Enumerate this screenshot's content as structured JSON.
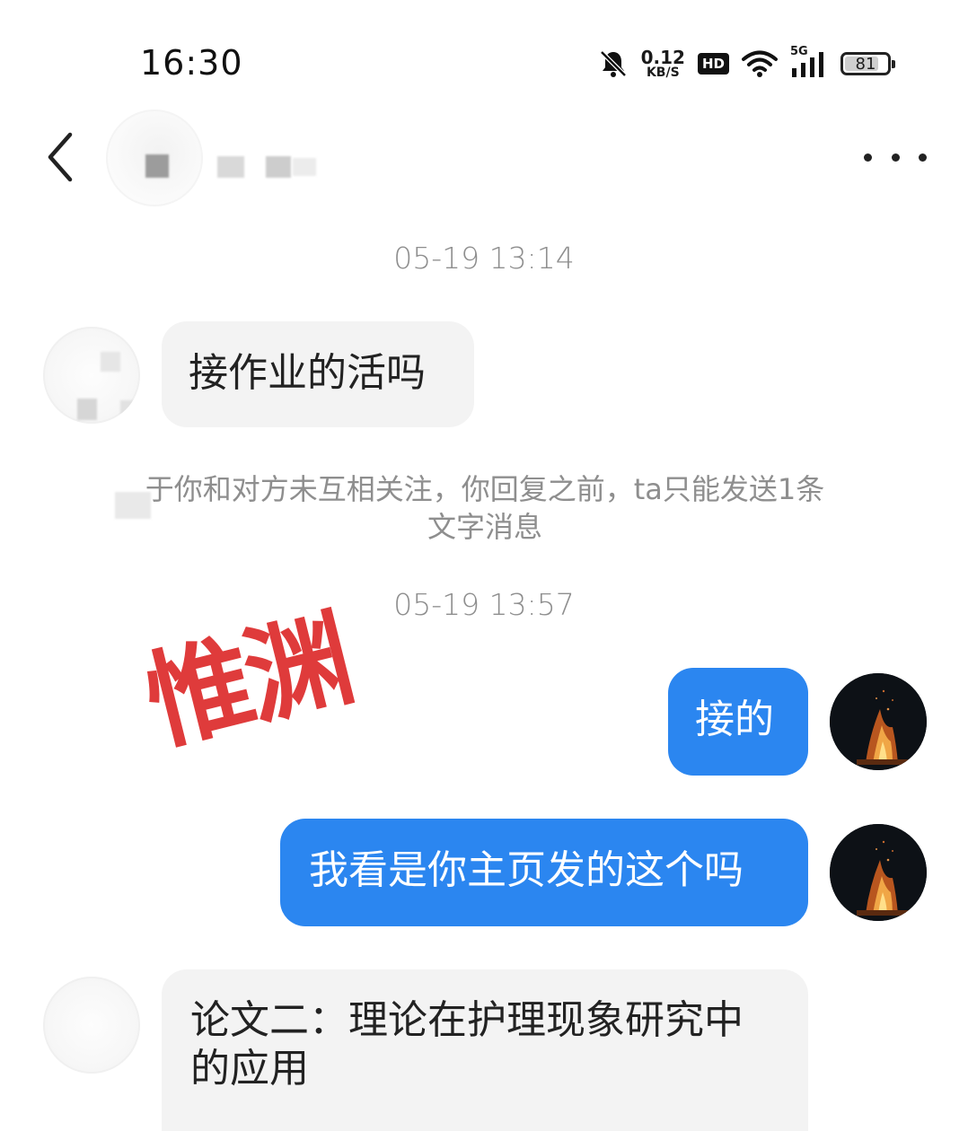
{
  "status_bar": {
    "time": "16:30",
    "net_speed_value": "0.12",
    "net_speed_unit": "KB/S",
    "hd_badge": "HD",
    "network_label": "5G",
    "battery_level": "81",
    "icons": [
      "bell-muted-icon",
      "wifi-icon",
      "signal-icon",
      "battery-icon"
    ]
  },
  "header": {
    "back_icon": "chevron-left-icon",
    "more_icon": "more-dots-icon"
  },
  "chat": {
    "timestamp_1": "05-19 13:14",
    "msg_1": "接作业的活吗",
    "notice": "于你和对方未互相关注，你回复之前，ta只能发送1条文字消息",
    "timestamp_2": "05-19 13:57",
    "msg_2": "接的",
    "msg_3": "我看是你主页发的这个吗",
    "msg_4": "论文二：理论在护理现象研究中的应用"
  },
  "watermark": "惟渊",
  "colors": {
    "outgoing_bubble": "#2b86f0",
    "incoming_bubble": "#f3f3f3",
    "timestamp_text": "#8e8e8e",
    "watermark_red": "#dd2b2b"
  }
}
